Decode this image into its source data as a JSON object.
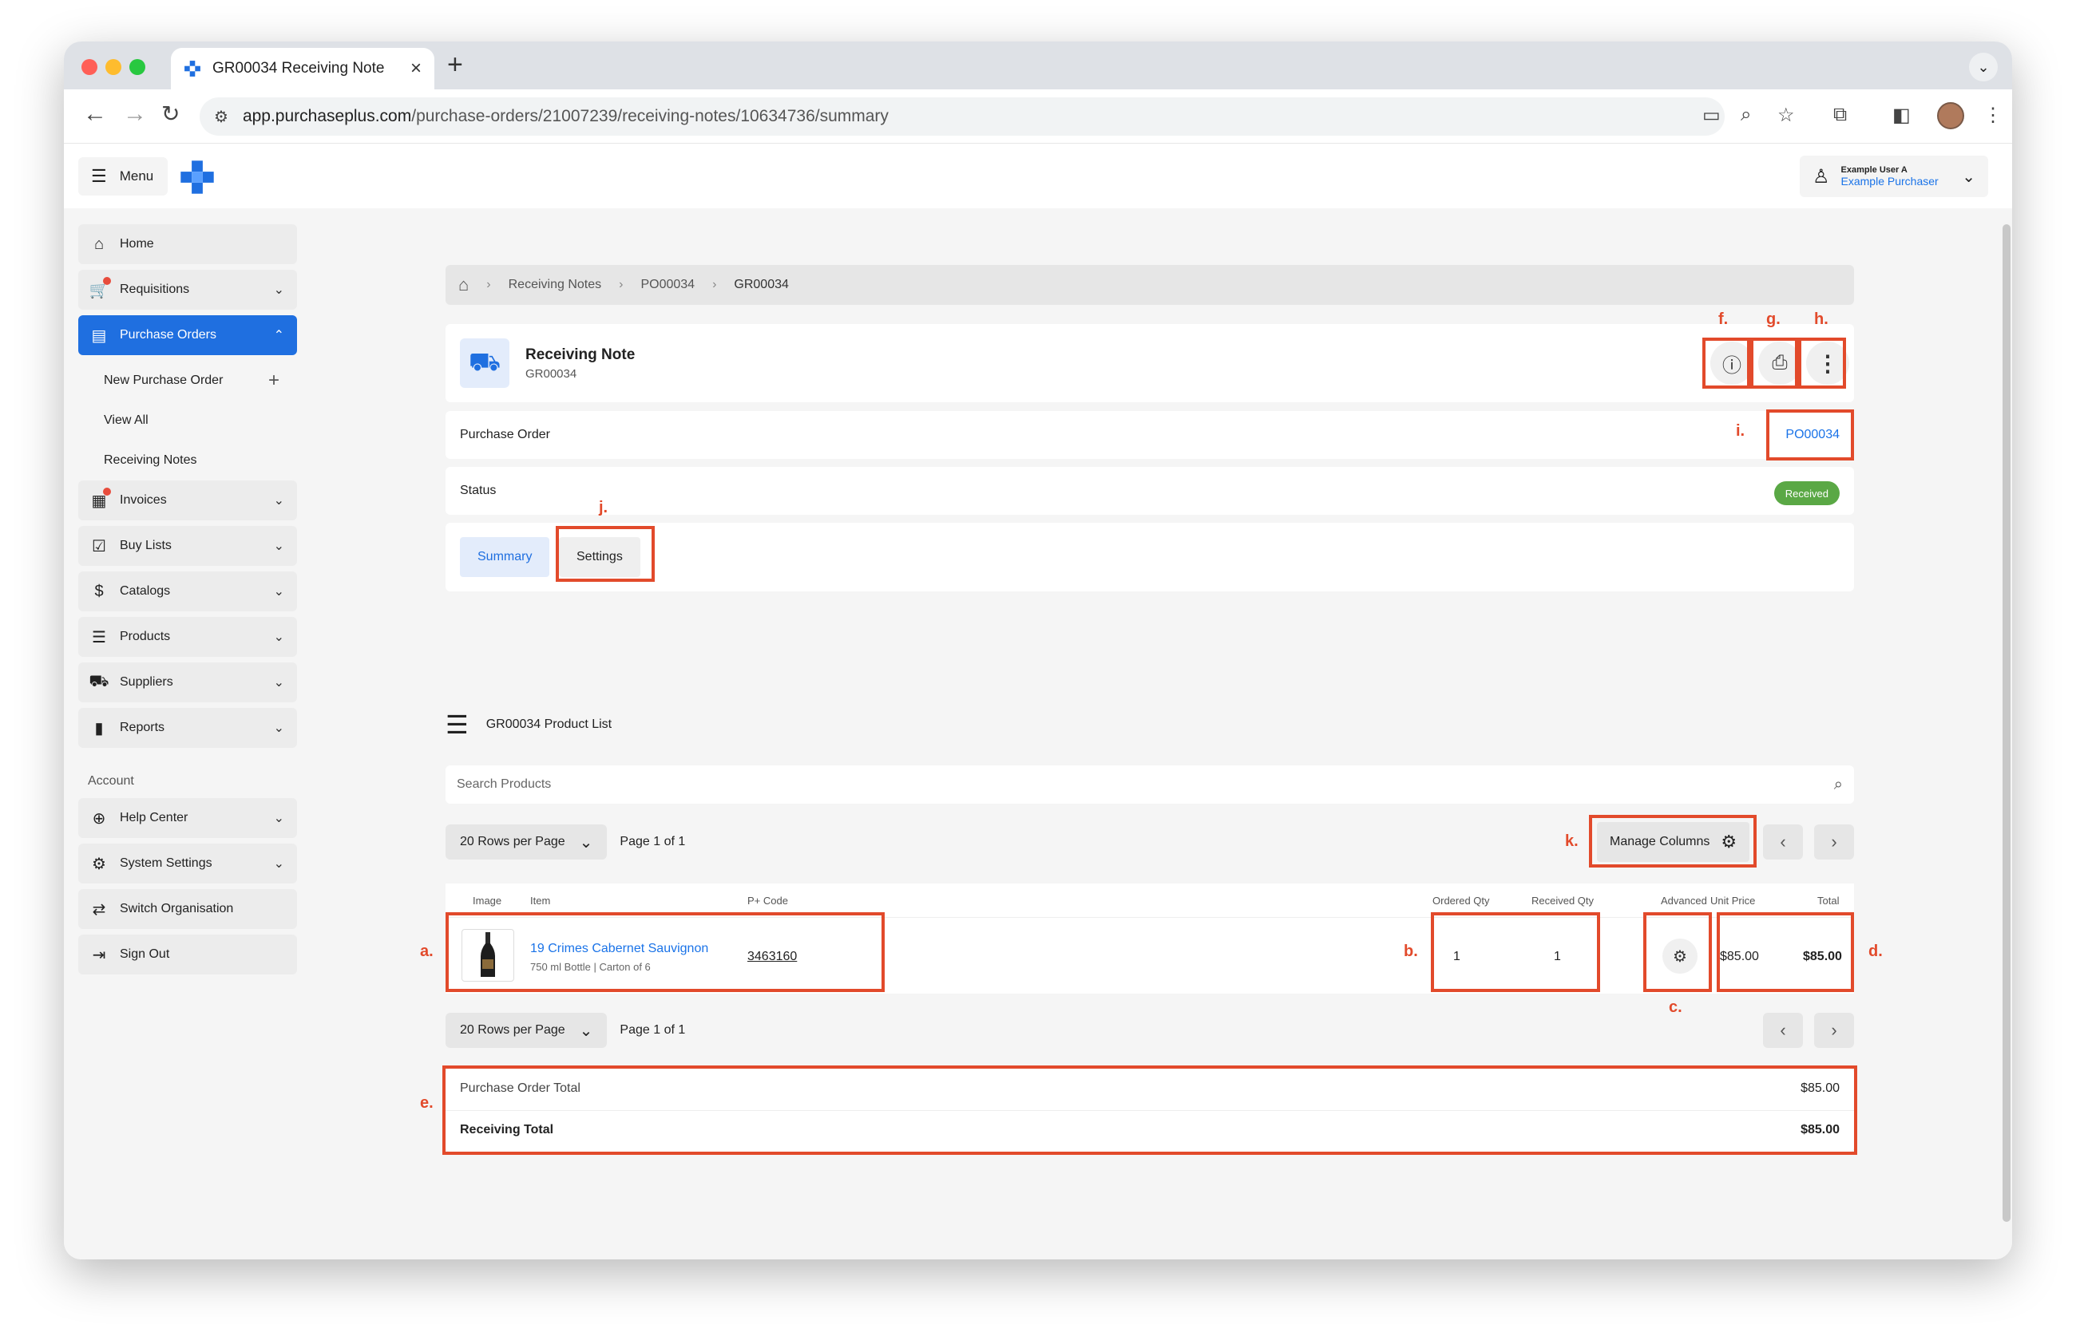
{
  "browser": {
    "tab_title": "GR00034 Receiving Note",
    "url_host": "app.purchaseplus.com",
    "url_path": "/purchase-orders/21007239/receiving-notes/10634736/summary"
  },
  "app": {
    "menu_label": "Menu",
    "user_name": "Example User A",
    "user_role": "Example Purchaser"
  },
  "sidebar": {
    "items": [
      {
        "label": "Home"
      },
      {
        "label": "Requisitions"
      },
      {
        "label": "Purchase Orders"
      },
      {
        "label": "Invoices"
      },
      {
        "label": "Buy Lists"
      },
      {
        "label": "Catalogs"
      },
      {
        "label": "Products"
      },
      {
        "label": "Suppliers"
      },
      {
        "label": "Reports"
      }
    ],
    "sub_items": [
      {
        "label": "New Purchase Order"
      },
      {
        "label": "View All"
      },
      {
        "label": "Receiving Notes"
      }
    ],
    "account_heading": "Account",
    "account_items": [
      {
        "label": "Help Center"
      },
      {
        "label": "System Settings"
      },
      {
        "label": "Switch Organisation"
      },
      {
        "label": "Sign Out"
      }
    ]
  },
  "breadcrumb": {
    "items": [
      "Receiving Notes",
      "PO00034",
      "GR00034"
    ]
  },
  "header": {
    "title": "Receiving Note",
    "subtitle": "GR00034"
  },
  "details": {
    "po_label": "Purchase Order",
    "po_value": "PO00034",
    "status_label": "Status",
    "status_value": "Received"
  },
  "tabs": {
    "summary": "Summary",
    "settings": "Settings"
  },
  "product_list": {
    "title": "GR00034 Product List",
    "search_placeholder": "Search Products",
    "rows_per_page": "20 Rows per Page",
    "page_info": "Page 1 of 1",
    "manage_columns": "Manage Columns",
    "columns": {
      "image": "Image",
      "item": "Item",
      "code": "P+ Code",
      "ordered": "Ordered Qty",
      "received": "Received Qty",
      "advanced": "Advanced",
      "unit_price": "Unit Price",
      "total": "Total"
    },
    "rows": [
      {
        "name": "19 Crimes Cabernet Sauvignon",
        "desc": "750 ml Bottle | Carton of 6",
        "code": "3463160",
        "ordered": "1",
        "received": "1",
        "unit_price": "$85.00",
        "total": "$85.00"
      }
    ]
  },
  "totals": {
    "po_total_label": "Purchase Order Total",
    "po_total_value": "$85.00",
    "receiving_total_label": "Receiving Total",
    "receiving_total_value": "$85.00"
  },
  "annotations": {
    "a": "a.",
    "b": "b.",
    "c": "c.",
    "d": "d.",
    "e": "e.",
    "f": "f.",
    "g": "g.",
    "h": "h.",
    "i": "i.",
    "j": "j.",
    "k": "k."
  },
  "colors": {
    "accent": "#1f6fe0",
    "highlight": "#e24a2b",
    "status_green": "#5aa845"
  }
}
